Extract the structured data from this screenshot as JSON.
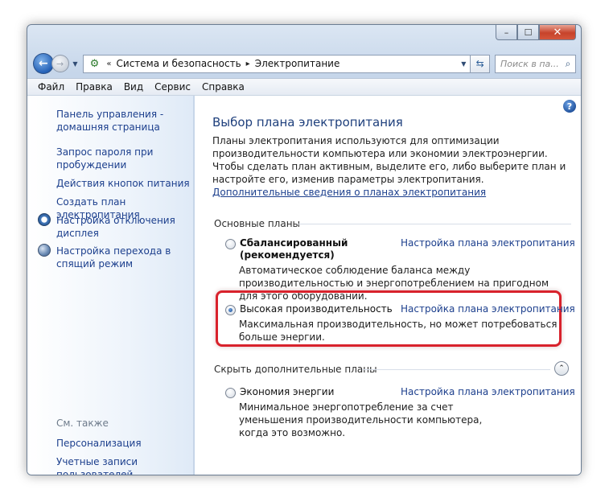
{
  "window": {
    "controls": {
      "minimize": "–",
      "maximize": "☐",
      "close": "✕"
    }
  },
  "nav": {
    "back_icon": "back-arrow-icon",
    "forward_icon": "forward-arrow-icon",
    "breadcrumb_prefix": "«",
    "breadcrumbs": [
      "Система и безопасность",
      "Электропитание"
    ],
    "separator": "▸",
    "search_placeholder": "Поиск в па...",
    "search_icon": "🔍"
  },
  "menu": [
    "Файл",
    "Правка",
    "Вид",
    "Сервис",
    "Справка"
  ],
  "sidebar": {
    "links": [
      "Панель управления -\nдомашняя страница",
      "Запрос пароля при\nпробуждении",
      "Действия кнопок питания",
      "Создать план электропитания",
      "Настройка отключения\nдисплея",
      "Настройка перехода в\nспящий режим"
    ],
    "see_also_label": "См. также",
    "see_also": [
      "Персонализация",
      "Учетные записи\nпользователей"
    ]
  },
  "content": {
    "title": "Выбор плана электропитания",
    "description": "Планы электропитания используются для оптимизации производительности компьютера или экономии электроэнергии. Чтобы сделать план активным, выделите его, либо выберите план и настройте его, изменив параметры электропитания.",
    "description_link": "Дополнительные сведения о планах электропитания",
    "main_plans_header": "Основные планы",
    "plans": [
      {
        "name": "Сбалансированный",
        "name_suffix": "(рекомендуется)",
        "link": "Настройка плана электропитания",
        "description": "Автоматическое соблюдение баланса между производительностью и энергопотреблением на пригодном для этого оборудовании.",
        "selected": false
      },
      {
        "name": "Высокая производительность",
        "link": "Настройка плана электропитания",
        "description": "Максимальная производительность, но может потребоваться больше энергии.",
        "selected": true
      }
    ],
    "extra_plans_header": "Скрыть дополнительные планы",
    "extra_plans": [
      {
        "name": "Экономия энергии",
        "link": "Настройка плана электропитания",
        "description": "Минимальное энергопотребление за счет уменьшения производительности компьютера, когда это возможно.",
        "selected": false
      }
    ],
    "help_label": "?",
    "collapse_label": "⌃"
  }
}
